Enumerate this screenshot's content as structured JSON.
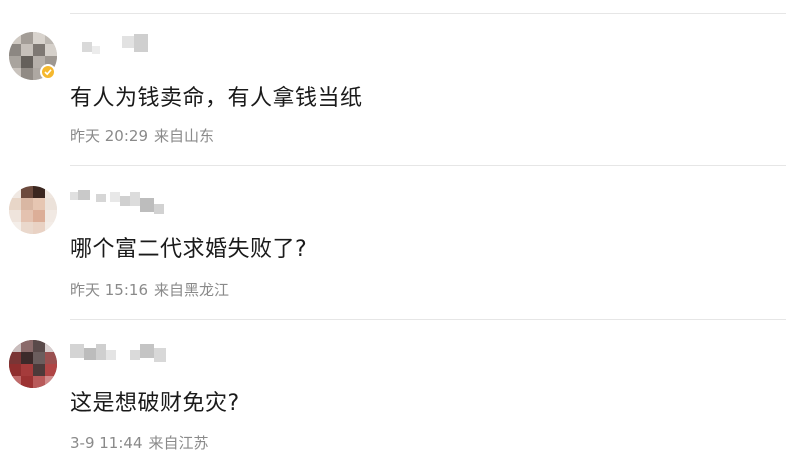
{
  "comments": [
    {
      "text": "有人为钱卖命，有人拿钱当纸",
      "time": "昨天 20:29",
      "location": "来自山东",
      "verified": true
    },
    {
      "text": "哪个富二代求婚失败了?",
      "time": "昨天 15:16",
      "location": "来自黑龙江",
      "verified": false
    },
    {
      "text": "这是想破财免灾?",
      "time": "3-9 11:44",
      "location": "来自江苏",
      "verified": false
    }
  ],
  "colors": {
    "text": "#1a1a1a",
    "meta": "#8a8a8a",
    "divider": "#e6e6e6",
    "verified_badge": "#f5b82e"
  }
}
